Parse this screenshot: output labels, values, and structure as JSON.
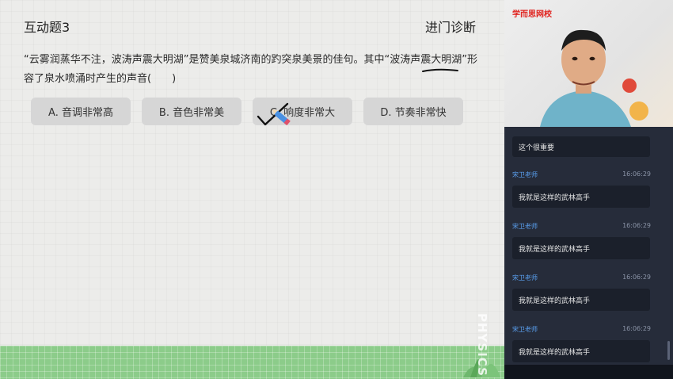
{
  "question": {
    "title": "互动题3",
    "tag": "进门诊断",
    "text": "“云雾润蒸华不注，波涛声震大明湖”是赞美泉城济南的趵突泉美景的佳句。其中“波涛声震大明湖”形容了泉水喷涌时产生的声音(　　)",
    "options": [
      {
        "label": "A. 音调非常高"
      },
      {
        "label": "B. 音色非常美"
      },
      {
        "label": "C. 响度非常大"
      },
      {
        "label": "D. 节奏非常快"
      }
    ],
    "selected_option": "C"
  },
  "decoration": {
    "watermark": "PHYSICS"
  },
  "video": {
    "brand": "学而思网校"
  },
  "chat": {
    "top_message": "这个很重要",
    "messages": [
      {
        "name": "宋卫老师",
        "time": "16:06:29",
        "text": "我就是这样的武林高手"
      },
      {
        "name": "宋卫老师",
        "time": "16:06:29",
        "text": "我就是这样的武林高手"
      },
      {
        "name": "宋卫老师",
        "time": "16:06:29",
        "text": "我就是这样的武林高手"
      },
      {
        "name": "宋卫老师",
        "time": "16:06:29",
        "text": "我就是这样的武林高手"
      }
    ]
  },
  "colors": {
    "board_bg": "#ececea",
    "option_bg": "#d6d6d6",
    "chat_bg": "#262c3a",
    "chat_name": "#5aa0f0",
    "brand_red": "#e0201c",
    "grass": "#8ccc8a"
  }
}
